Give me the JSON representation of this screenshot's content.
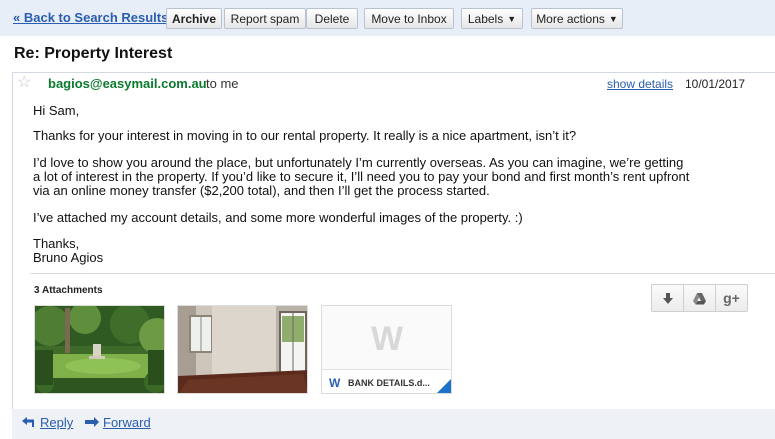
{
  "toolbar": {
    "back_link": "« Back to Search Results",
    "archive": "Archive",
    "report_spam": "Report spam",
    "delete": "Delete",
    "move_to_inbox": "Move to Inbox",
    "labels": "Labels",
    "more_actions": "More actions"
  },
  "subject": "Re: Property Interest",
  "message": {
    "sender": "bagios@easymail.com.au",
    "recipient": "to me",
    "show_details": "show details",
    "date": "10/01/2017",
    "greeting": "Hi Sam,",
    "paragraph_1": "Thanks for your interest in moving in to our rental property. It really is a nice apartment, isn’t it?",
    "paragraph_2_line_1": "I’d love to show you around the place, but unfortunately I’m currently overseas. As you can imagine, we’re getting",
    "paragraph_2_line_2": "a lot of interest in the property. If you’d like to secure it, I’ll need you to pay your bond and first month’s rent upfront",
    "paragraph_2_line_3": "via an online money transfer ($2,200 total), and then I’ll get the process started.",
    "paragraph_3": "I’ve attached my account details, and some more wonderful images of the property. :)",
    "signoff": "Thanks,",
    "signature": "Bruno Agios"
  },
  "attachments": {
    "count_label": "3 Attachments",
    "doc_letter": "W",
    "doc_name": "BANK DETAILS.d..."
  },
  "icons": {
    "download": "download-icon",
    "drive": "drive-icon",
    "gplus": "google-plus-icon",
    "gplus_text": "g+"
  },
  "footer": {
    "reply": "Reply",
    "forward": "Forward"
  },
  "colors": {
    "toolbar_bg": "#e8eef7",
    "link": "#2a5db0",
    "sender": "#0b7a2e",
    "word_blue": "#2b5fb4"
  }
}
